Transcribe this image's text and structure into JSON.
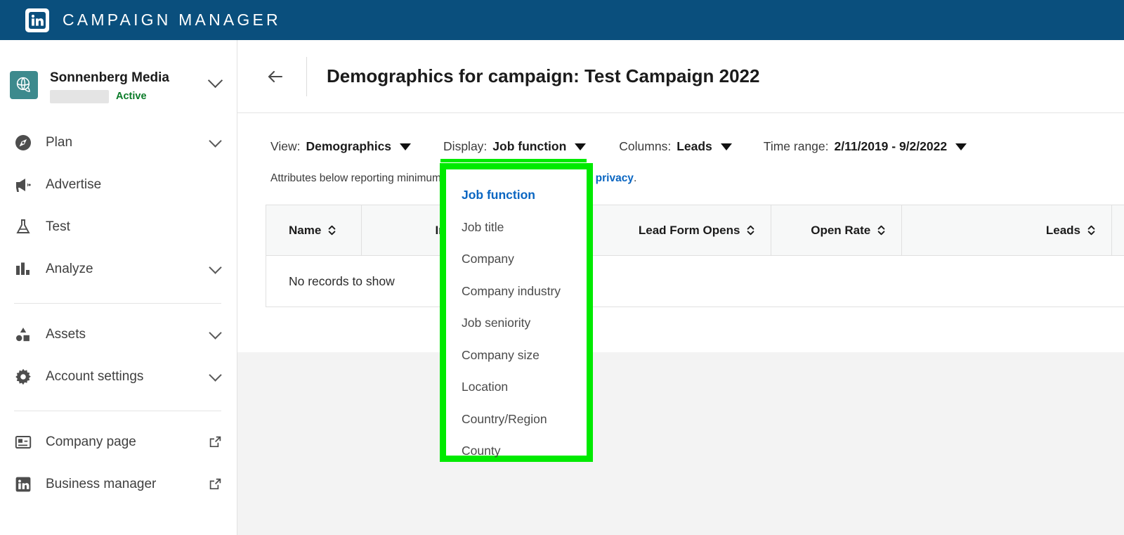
{
  "topbar": {
    "logo_text": "in",
    "brand": "CAMPAIGN MANAGER"
  },
  "sidebar": {
    "account": {
      "name": "Sonnenberg Media",
      "status": "Active",
      "logo_icon": "leaf-globe-icon",
      "expand_icon": "chevron-down-icon"
    },
    "items": [
      {
        "label": "Plan",
        "icon": "compass-icon",
        "end": "chevron-down-icon"
      },
      {
        "label": "Advertise",
        "icon": "megaphone-icon",
        "end": ""
      },
      {
        "label": "Test",
        "icon": "flask-icon",
        "end": ""
      },
      {
        "label": "Analyze",
        "icon": "bar-chart-icon",
        "end": "chevron-down-icon"
      }
    ],
    "items2": [
      {
        "label": "Assets",
        "icon": "shapes-icon",
        "end": "chevron-down-icon"
      },
      {
        "label": "Account settings",
        "icon": "gear-icon",
        "end": "chevron-down-icon"
      }
    ],
    "items3": [
      {
        "label": "Company page",
        "icon": "company-page-icon",
        "end": "external-link-icon"
      },
      {
        "label": "Business manager",
        "icon": "linkedin-icon",
        "end": "external-link-icon"
      }
    ]
  },
  "header": {
    "back_icon": "back-arrow-icon",
    "title": "Demographics for campaign: Test Campaign 2022"
  },
  "toolbar": {
    "view_label": "View:",
    "view_value": "Demographics",
    "display_label": "Display:",
    "display_value": "Job function",
    "columns_label": "Columns:",
    "columns_value": "Leads",
    "timerange_label": "Time range:",
    "timerange_value": "2/11/2019 - 9/2/2022",
    "caret_icon": "caret-down-icon"
  },
  "notice": {
    "text_before": "Attributes below reporting minimums are not shown to protect ",
    "link": "user privacy",
    "text_after": "."
  },
  "table": {
    "columns": [
      "Name",
      "Impressions",
      "Lead Form Opens",
      "Open Rate",
      "Leads"
    ],
    "sort_icon": "sort-updown-icon",
    "empty_text": "No records to show",
    "rows": []
  },
  "dropdown": {
    "highlight_color": "#00ea00",
    "selected": "Job function",
    "items": [
      "Job function",
      "Job title",
      "Company",
      "Company industry",
      "Job seniority",
      "Company size",
      "Location",
      "Country/Region",
      "County"
    ]
  }
}
